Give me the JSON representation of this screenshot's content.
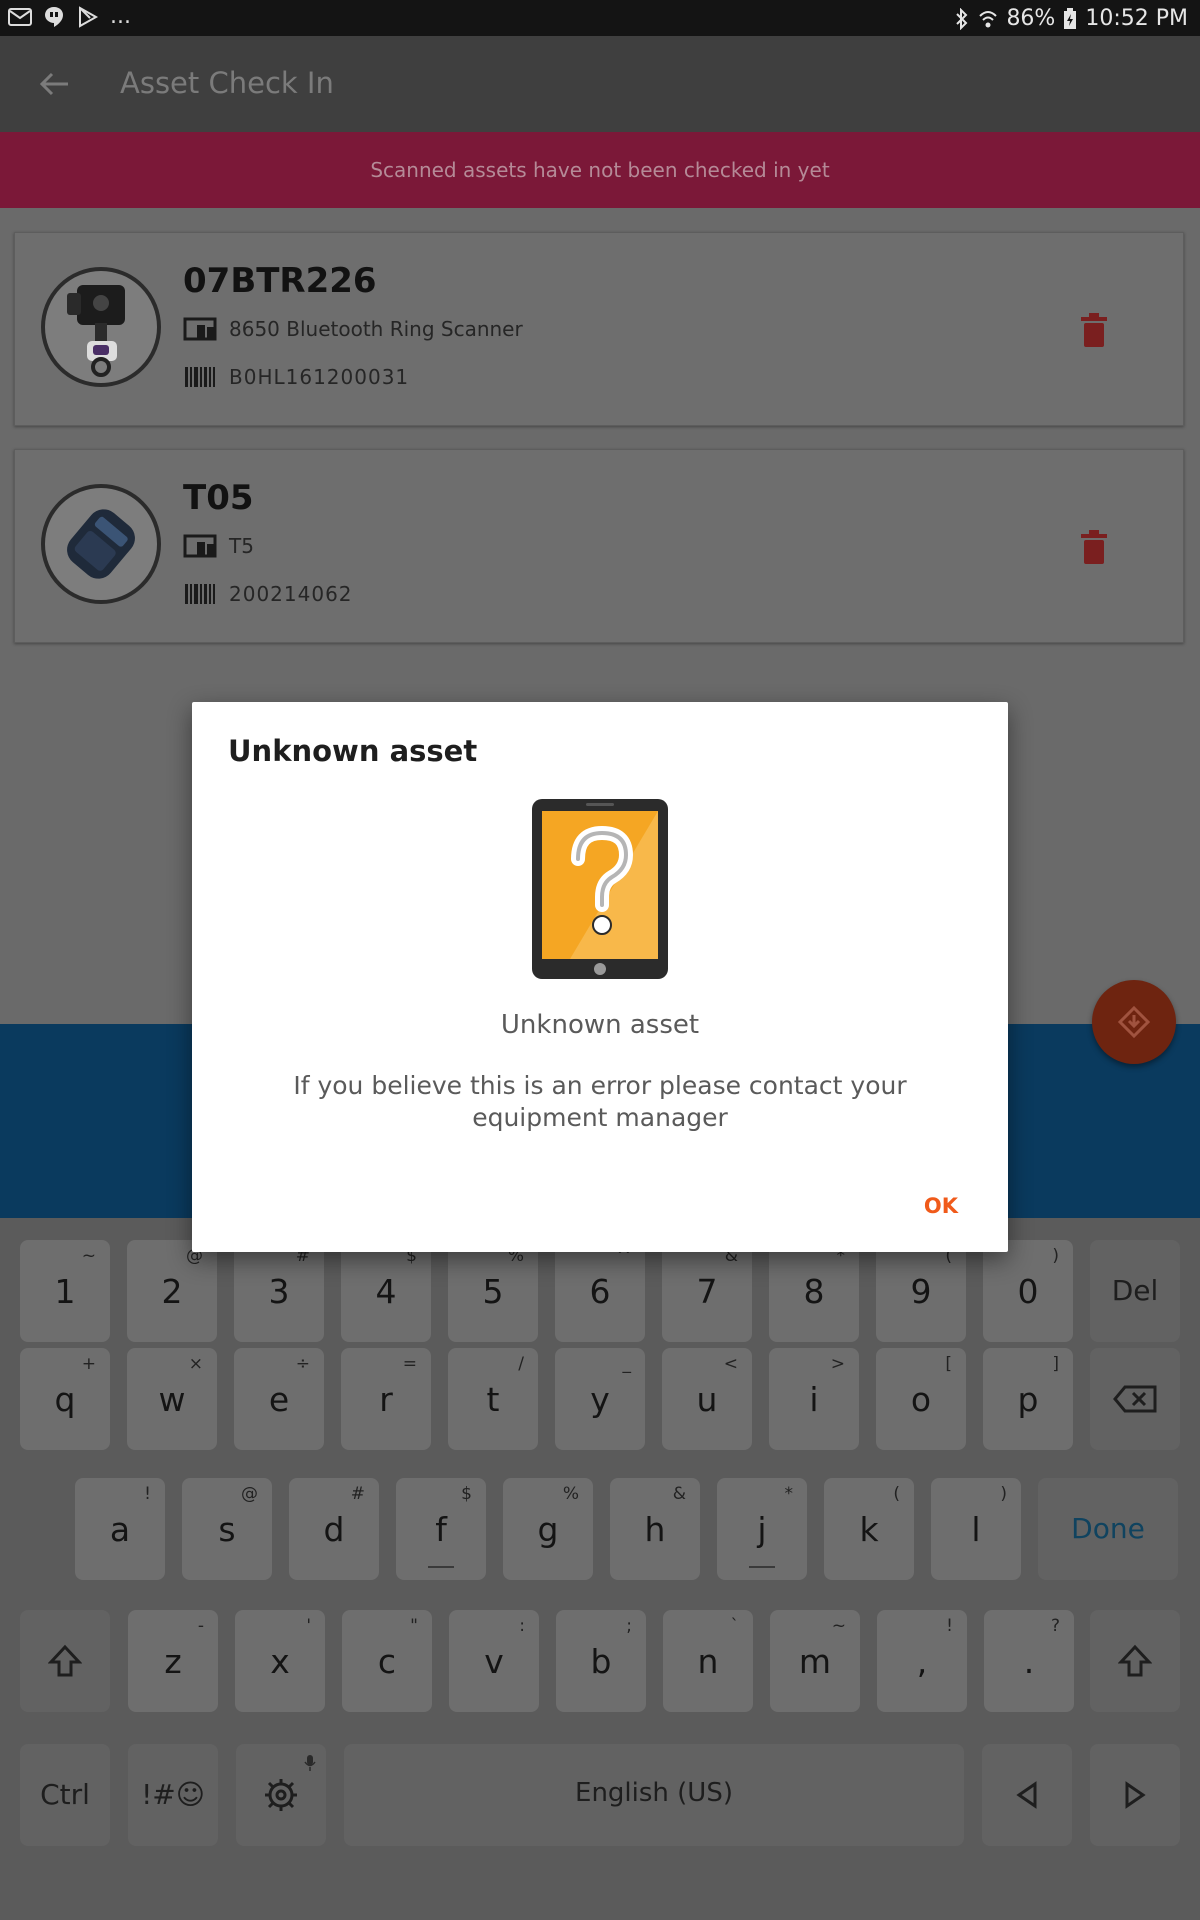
{
  "status_bar": {
    "battery": "86%",
    "time": "10:52 PM",
    "overflow": "..."
  },
  "app_bar": {
    "title": "Asset Check In"
  },
  "banner": {
    "text": "Scanned assets have not been checked in yet"
  },
  "assets": [
    {
      "name": "07BTR226",
      "model": "8650 Bluetooth Ring Scanner",
      "serial": "B0HL161200031"
    },
    {
      "name": "T05",
      "model": "T5",
      "serial": "200214062"
    }
  ],
  "dialog": {
    "title": "Unknown asset",
    "image_icon": "question-mark-tablet-icon",
    "subtitle": "Unknown asset",
    "message": "If you believe this is an error please contact your equipment manager",
    "ok_label": "OK",
    "accent_color": "#f05a1a"
  },
  "keyboard": {
    "row1": [
      {
        "main": "1",
        "sub": "~"
      },
      {
        "main": "2",
        "sub": "@"
      },
      {
        "main": "3",
        "sub": "#"
      },
      {
        "main": "4",
        "sub": "$"
      },
      {
        "main": "5",
        "sub": "%"
      },
      {
        "main": "6",
        "sub": "^"
      },
      {
        "main": "7",
        "sub": "&"
      },
      {
        "main": "8",
        "sub": "*"
      },
      {
        "main": "9",
        "sub": "("
      },
      {
        "main": "0",
        "sub": ")"
      }
    ],
    "del_label": "Del",
    "row2": [
      {
        "main": "q",
        "sub": "+"
      },
      {
        "main": "w",
        "sub": "×"
      },
      {
        "main": "e",
        "sub": "÷"
      },
      {
        "main": "r",
        "sub": "="
      },
      {
        "main": "t",
        "sub": "/"
      },
      {
        "main": "y",
        "sub": "_"
      },
      {
        "main": "u",
        "sub": "<"
      },
      {
        "main": "i",
        "sub": ">"
      },
      {
        "main": "o",
        "sub": "["
      },
      {
        "main": "p",
        "sub": "]"
      }
    ],
    "row3": [
      {
        "main": "a",
        "sub": "!"
      },
      {
        "main": "s",
        "sub": "@"
      },
      {
        "main": "d",
        "sub": "#"
      },
      {
        "main": "f",
        "sub": "$"
      },
      {
        "main": "g",
        "sub": "%"
      },
      {
        "main": "h",
        "sub": "&"
      },
      {
        "main": "j",
        "sub": "*"
      },
      {
        "main": "k",
        "sub": "("
      },
      {
        "main": "l",
        "sub": ")"
      }
    ],
    "done_label": "Done",
    "row4": [
      {
        "main": "z",
        "sub": "-"
      },
      {
        "main": "x",
        "sub": "'"
      },
      {
        "main": "c",
        "sub": "\""
      },
      {
        "main": "v",
        "sub": ":"
      },
      {
        "main": "b",
        "sub": ";"
      },
      {
        "main": "n",
        "sub": "`"
      },
      {
        "main": "m",
        "sub": "~"
      },
      {
        "main": ",",
        "sub": "!"
      },
      {
        "main": ".",
        "sub": "?"
      }
    ],
    "ctrl_label": "Ctrl",
    "symbols_label": "!#☺",
    "space_label": "English (US)"
  }
}
